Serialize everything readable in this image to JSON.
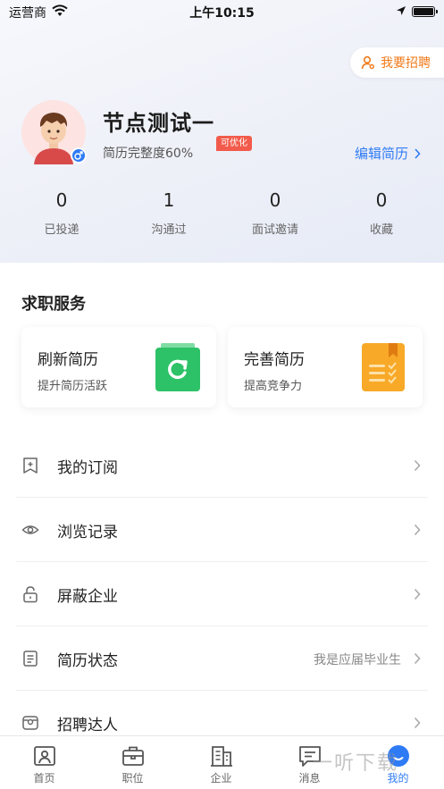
{
  "status_bar": {
    "carrier": "运营商",
    "time": "上午10:15"
  },
  "header": {
    "recruit_label": "我要招聘",
    "user_name": "节点测试一",
    "completeness": "简历完整度60%",
    "optimize_tag": "可优化",
    "edit_resume": "编辑简历"
  },
  "stats": [
    {
      "value": "0",
      "label": "已投递"
    },
    {
      "value": "1",
      "label": "沟通过"
    },
    {
      "value": "0",
      "label": "面试邀请"
    },
    {
      "value": "0",
      "label": "收藏"
    }
  ],
  "services": {
    "title": "求职服务",
    "cards": [
      {
        "title": "刷新简历",
        "subtitle": "提升简历活跃",
        "icon": "refresh-icon",
        "color": "#2dc268"
      },
      {
        "title": "完善简历",
        "subtitle": "提高竞争力",
        "icon": "checklist-icon",
        "color": "#f8a928"
      }
    ]
  },
  "menu": [
    {
      "label": "我的订阅",
      "icon": "bookmark-icon",
      "extra": ""
    },
    {
      "label": "浏览记录",
      "icon": "eye-icon",
      "extra": ""
    },
    {
      "label": "屏蔽企业",
      "icon": "lock-icon",
      "extra": ""
    },
    {
      "label": "简历状态",
      "icon": "document-icon",
      "extra": "我是应届毕业生"
    },
    {
      "label": "招聘达人",
      "icon": "badge-icon",
      "extra": ""
    }
  ],
  "tabs": [
    {
      "label": "首页",
      "icon": "home-icon"
    },
    {
      "label": "职位",
      "icon": "briefcase-icon"
    },
    {
      "label": "企业",
      "icon": "building-icon"
    },
    {
      "label": "消息",
      "icon": "message-icon"
    },
    {
      "label": "我的",
      "icon": "profile-icon",
      "active": true
    }
  ],
  "watermark": "一听下载",
  "colors": {
    "accent": "#2f7bf5",
    "orange": "#f07a1a",
    "tag": "#f25b4b"
  }
}
